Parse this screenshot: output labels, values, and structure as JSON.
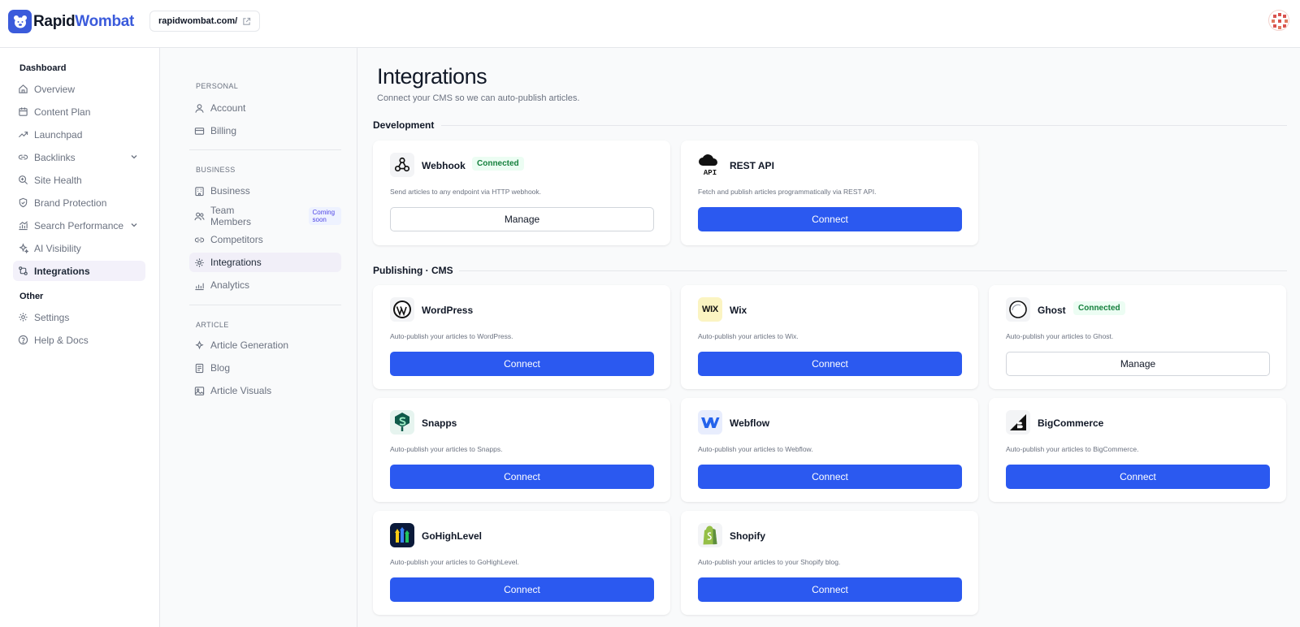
{
  "header": {
    "logo_part1": "Rapid",
    "logo_part2": "Wombat",
    "domain": "rapidwombat.com/"
  },
  "sidebar": {
    "section_dashboard": "Dashboard",
    "items": [
      {
        "label": "Overview",
        "icon": "home-icon"
      },
      {
        "label": "Content Plan",
        "icon": "calendar-icon"
      },
      {
        "label": "Launchpad",
        "icon": "trending-up-icon"
      },
      {
        "label": "Backlinks",
        "icon": "link-icon"
      },
      {
        "label": "Site Health",
        "icon": "search-health-icon"
      },
      {
        "label": "Brand Protection",
        "icon": "shield-icon"
      },
      {
        "label": "Search Performance",
        "icon": "chart-icon"
      },
      {
        "label": "AI Visibility",
        "icon": "sparkles-icon"
      },
      {
        "label": "Integrations",
        "icon": "integrations-icon"
      }
    ],
    "section_other": "Other",
    "other_items": [
      {
        "label": "Settings",
        "icon": "gear-icon"
      },
      {
        "label": "Help & Docs",
        "icon": "help-icon"
      }
    ]
  },
  "settings_nav": {
    "personal_label": "PERSONAL",
    "account": "Account",
    "billing": "Billing",
    "business_label": "BUSINESS",
    "business": "Business",
    "team_members": "Team Members",
    "coming_soon": "Coming soon",
    "competitors": "Competitors",
    "integrations": "Integrations",
    "analytics": "Analytics",
    "article_label": "ARTICLE",
    "article_generation": "Article Generation",
    "blog": "Blog",
    "article_visuals": "Article Visuals"
  },
  "main": {
    "title": "Integrations",
    "subtitle": "Connect your CMS so we can auto-publish articles.",
    "section_dev": "Development",
    "section_cms": "Publishing · CMS",
    "connected_label": "Connected",
    "cards": [
      {
        "name": "Webhook",
        "desc": "Send articles to any endpoint via HTTP webhook.",
        "button": "Manage"
      },
      {
        "name": "REST API",
        "desc": "Fetch and publish articles programmatically via REST API.",
        "button": "Connect"
      },
      {
        "name": "WordPress",
        "desc": "Auto-publish your articles to WordPress.",
        "button": "Connect"
      },
      {
        "name": "Wix",
        "desc": "Auto-publish your articles to Wix.",
        "button": "Connect"
      },
      {
        "name": "Ghost",
        "desc": "Auto-publish your articles to Ghost.",
        "button": "Manage"
      },
      {
        "name": "Snapps",
        "desc": "Auto-publish your articles to Snapps.",
        "button": "Connect"
      },
      {
        "name": "Webflow",
        "desc": "Auto-publish your articles to Webflow.",
        "button": "Connect"
      },
      {
        "name": "BigCommerce",
        "desc": "Auto-publish your articles to BigCommerce.",
        "button": "Connect"
      },
      {
        "name": "GoHighLevel",
        "desc": "Auto-publish your articles to GoHighLevel.",
        "button": "Connect"
      },
      {
        "name": "Shopify",
        "desc": "Auto-publish your articles to your Shopify blog.",
        "button": "Connect"
      }
    ],
    "logo_text": {
      "rest_api": "API",
      "wix": "WIX"
    }
  },
  "colors": {
    "brand": "#3b5bdb",
    "primary_button": "#2b59f0",
    "connected_green": "#15803d",
    "active_bg": "#f3f1fa"
  }
}
